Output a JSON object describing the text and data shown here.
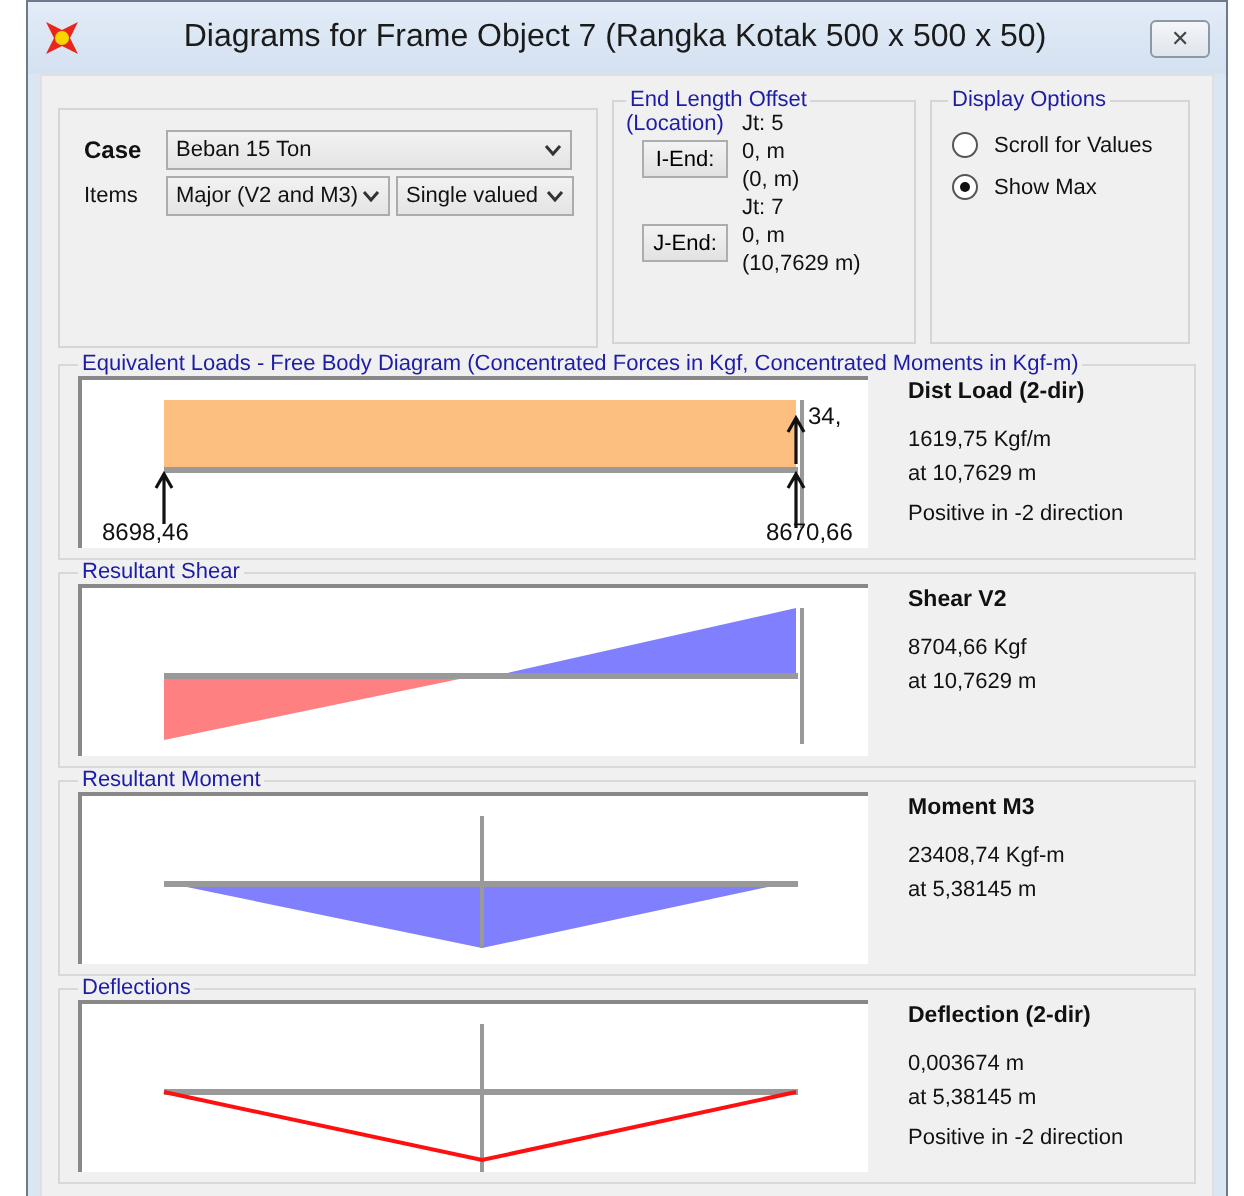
{
  "window": {
    "title": "Diagrams for Frame Object 7  (Rangka Kotak 500 x 500 x 50)",
    "close": "✕"
  },
  "case_panel": {
    "case_label": "Case",
    "case_value": "Beban 15 Ton",
    "items_label": "Items",
    "items_value": "Major (V2 and M3)",
    "mode_value": "Single valued"
  },
  "end_length_offset": {
    "title": "End Length Offset",
    "subtitle": "(Location)",
    "ends": [
      {
        "button": "I-End:",
        "joint": "Jt:  5",
        "offset": "0, m",
        "location": "(0, m)"
      },
      {
        "button": "J-End:",
        "joint": "Jt:  7",
        "offset": "0, m",
        "location": "(10,7629 m)"
      }
    ]
  },
  "display_options": {
    "title": "Display Options",
    "options": [
      {
        "label": "Scroll for Values",
        "selected": false
      },
      {
        "label": "Show Max",
        "selected": true
      }
    ]
  },
  "sections": [
    {
      "kind": "loads",
      "title": "Equivalent Loads - Free Body Diagram  (Concentrated Forces in Kgf, Concentrated Moments in Kgf-m)",
      "left_value": "8698,46",
      "right_value": "8670,66",
      "top_value": "34,",
      "heading": "Dist Load (2-dir)",
      "lines": [
        "1619,75 Kgf/m",
        "at 10,7629 m"
      ],
      "note": "Positive in -2 direction"
    },
    {
      "kind": "shear",
      "title": "Resultant Shear",
      "heading": "Shear V2",
      "lines": [
        "8704,66 Kgf",
        "at 10,7629 m"
      ]
    },
    {
      "kind": "moment",
      "title": "Resultant Moment",
      "heading": "Moment M3",
      "lines": [
        "23408,74 Kgf-m",
        "at 5,38145 m"
      ]
    },
    {
      "kind": "deflection",
      "title": "Deflections",
      "heading": "Deflection (2-dir)",
      "lines": [
        "0,003674 m",
        "at 5,38145 m"
      ],
      "note": "Positive in -2 direction"
    }
  ]
}
